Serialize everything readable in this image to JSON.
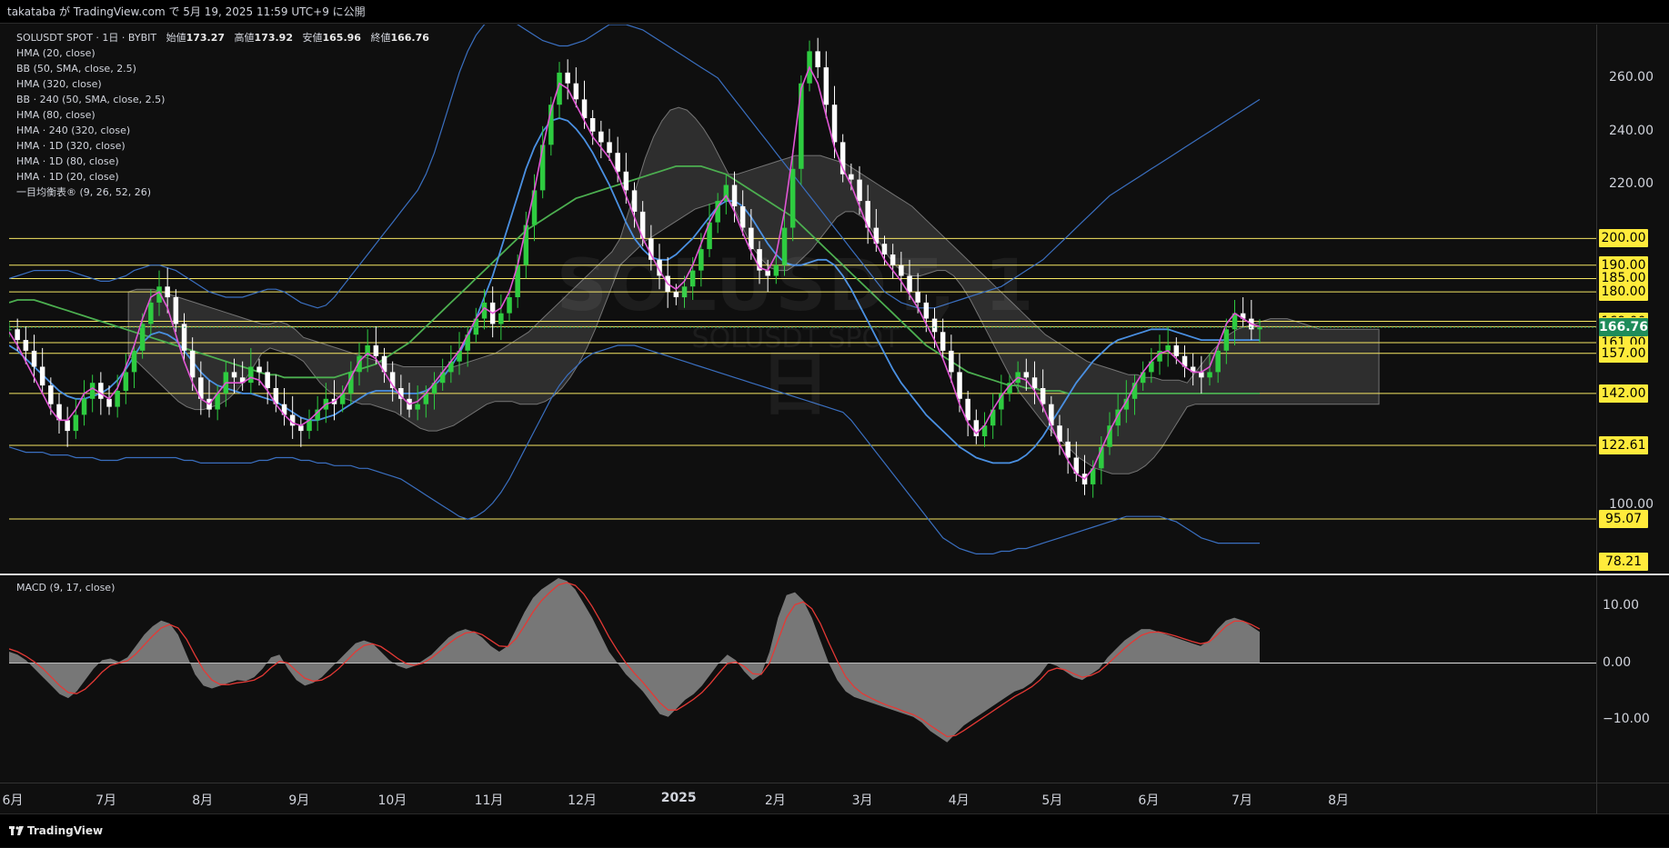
{
  "header": {
    "published": "takataba が TradingView.com で 5月 19, 2025 11:59 UTC+9 に公開"
  },
  "legend": {
    "symbol": "SOLUSDT SPOT · 1日 · BYBIT",
    "open_label": "始値",
    "open": "173.27",
    "high_label": "高値",
    "high": "173.92",
    "low_label": "安値",
    "low": "165.96",
    "close_label": "終値",
    "close": "166.76",
    "indicators": [
      "HMA (20, close)",
      "BB (50, SMA, close, 2.5)",
      "HMA (320, close)",
      "BB · 240 (50, SMA, close, 2.5)",
      "HMA (80, close)",
      "HMA · 240 (320, close)",
      "HMA · 1D (320, close)",
      "HMA · 1D (80, close)",
      "HMA · 1D (20, close)",
      "一目均衡表® (9, 26, 52, 26)"
    ]
  },
  "watermark": {
    "title": "SOLUSDT, 1日",
    "subtitle": "SOLUSDT SPOT"
  },
  "macd_legend": "MACD (9, 17, close)",
  "footer": {
    "brand": "TradingView"
  },
  "colors": {
    "up": "#2ecc40",
    "down": "#ffffff",
    "hma20": "#e056d4",
    "hma80": "#4a90e2",
    "hma320": "#4caf50",
    "bb": "#3a6fc0",
    "level": "#f5e663",
    "macd_hist": "#8a8a8a",
    "macd_signal": "#e53935"
  },
  "chart_data": [
    {
      "type": "candlestick",
      "title": "SOLUSDT SPOT · 1日 · BYBIT",
      "ylim": [
        75,
        280
      ],
      "x_ticks": [
        {
          "label": "6月",
          "pos": 0.0
        },
        {
          "label": "7月",
          "pos": 0.0588
        },
        {
          "label": "8月",
          "pos": 0.1196
        },
        {
          "label": "9月",
          "pos": 0.1804
        },
        {
          "label": "10月",
          "pos": 0.2392
        },
        {
          "label": "11月",
          "pos": 0.3
        },
        {
          "label": "12月",
          "pos": 0.3588
        },
        {
          "label": "2025",
          "pos": 0.4196
        },
        {
          "label": "2月",
          "pos": 0.4804
        },
        {
          "label": "3月",
          "pos": 0.5353
        },
        {
          "label": "4月",
          "pos": 0.5961
        },
        {
          "label": "5月",
          "pos": 0.6549
        },
        {
          "label": "6月",
          "pos": 0.7157
        },
        {
          "label": "7月",
          "pos": 0.7745
        },
        {
          "label": "8月",
          "pos": 0.8353
        }
      ],
      "y_ticks": [
        100,
        220,
        240,
        260
      ],
      "horizontal_levels": [
        200,
        190,
        185,
        180,
        169,
        167,
        161,
        157,
        142,
        122.61,
        95.07
      ],
      "price_tags": [
        "200.00",
        "190.00",
        "185.00",
        "180.00",
        "169.00",
        "167.00",
        "161.00",
        "157.00",
        "142.00",
        "122.61",
        "95.07",
        "78.21"
      ],
      "current_price": "166.76",
      "close_series": [
        166,
        162,
        158,
        152,
        145,
        138,
        132,
        128,
        134,
        140,
        146,
        140,
        137,
        143,
        150,
        158,
        168,
        176,
        182,
        178,
        168,
        158,
        148,
        140,
        136,
        142,
        150,
        148,
        146,
        152,
        150,
        144,
        138,
        134,
        130,
        128,
        132,
        136,
        140,
        138,
        142,
        150,
        156,
        160,
        156,
        150,
        144,
        140,
        136,
        138,
        142,
        146,
        150,
        154,
        158,
        164,
        170,
        176,
        168,
        172,
        178,
        190,
        205,
        218,
        235,
        250,
        262,
        258,
        252,
        245,
        240,
        236,
        232,
        225,
        218,
        210,
        200,
        192,
        186,
        180,
        178,
        182,
        188,
        196,
        206,
        214,
        220,
        212,
        204,
        196,
        188,
        186,
        190,
        204,
        226,
        258,
        270,
        264,
        250,
        236,
        224,
        222,
        214,
        204,
        198,
        194,
        190,
        186,
        180,
        176,
        170,
        165,
        158,
        150,
        140,
        132,
        126,
        130,
        136,
        142,
        146,
        150,
        148,
        144,
        138,
        130,
        124,
        118,
        112,
        108,
        114,
        122,
        130,
        136,
        140,
        146,
        150,
        154,
        158,
        160,
        156,
        152,
        150,
        148,
        150,
        158,
        166,
        172,
        170,
        166,
        166.76
      ],
      "hma20_series": [
        165,
        160,
        154,
        148,
        142,
        136,
        132,
        132,
        136,
        142,
        144,
        142,
        140,
        144,
        152,
        160,
        170,
        178,
        180,
        174,
        164,
        154,
        146,
        140,
        138,
        142,
        146,
        146,
        146,
        148,
        147,
        143,
        138,
        134,
        131,
        130,
        132,
        135,
        138,
        139,
        142,
        148,
        154,
        157,
        155,
        150,
        145,
        141,
        138,
        139,
        142,
        146,
        150,
        154,
        158,
        164,
        170,
        174,
        172,
        174,
        180,
        190,
        204,
        218,
        234,
        248,
        258,
        256,
        250,
        244,
        238,
        234,
        230,
        224,
        216,
        208,
        200,
        194,
        188,
        183,
        181,
        184,
        190,
        198,
        206,
        212,
        216,
        210,
        202,
        195,
        189,
        188,
        194,
        210,
        232,
        256,
        264,
        258,
        246,
        234,
        226,
        220,
        212,
        204,
        198,
        192,
        188,
        184,
        179,
        174,
        168,
        162,
        155,
        147,
        138,
        131,
        127,
        130,
        136,
        141,
        145,
        148,
        147,
        143,
        137,
        130,
        123,
        117,
        112,
        110,
        114,
        121,
        128,
        134,
        139,
        145,
        150,
        154,
        157,
        158,
        155,
        152,
        150,
        150,
        152,
        160,
        168,
        172,
        170,
        168,
        167
      ],
      "hma80_series": [
        160,
        158,
        155,
        152,
        149,
        146,
        143,
        141,
        140,
        140,
        141,
        142,
        144,
        147,
        151,
        156,
        161,
        164,
        165,
        164,
        162,
        158,
        154,
        150,
        147,
        145,
        144,
        143,
        142,
        142,
        141,
        140,
        139,
        137,
        135,
        133,
        132,
        132,
        133,
        134,
        136,
        138,
        140,
        142,
        143,
        143,
        143,
        142,
        142,
        142,
        143,
        145,
        148,
        152,
        157,
        163,
        170,
        178,
        186,
        196,
        206,
        216,
        226,
        234,
        240,
        244,
        245,
        244,
        241,
        237,
        232,
        226,
        220,
        213,
        206,
        200,
        196,
        193,
        192,
        192,
        194,
        197,
        200,
        204,
        208,
        212,
        214,
        214,
        212,
        208,
        203,
        198,
        194,
        191,
        190,
        190,
        191,
        192,
        192,
        190,
        186,
        181,
        175,
        169,
        163,
        157,
        151,
        146,
        142,
        138,
        134,
        131,
        128,
        125,
        122,
        120,
        118,
        117,
        116,
        116,
        116,
        117,
        119,
        122,
        126,
        131,
        136,
        141,
        146,
        150,
        154,
        157,
        160,
        162,
        163,
        164,
        165,
        166,
        166,
        166,
        165,
        164,
        163,
        162,
        162,
        162,
        162,
        162,
        162,
        162,
        162
      ],
      "hma320_series": [
        176,
        177,
        177,
        177,
        176,
        175,
        174,
        173,
        172,
        171,
        170,
        169,
        168,
        167,
        166,
        165,
        164,
        163,
        162,
        161,
        160,
        159,
        158,
        157,
        156,
        155,
        154,
        153,
        152,
        151,
        150,
        149,
        149,
        148,
        148,
        148,
        148,
        148,
        148,
        148,
        149,
        150,
        151,
        152,
        153,
        155,
        157,
        159,
        161,
        164,
        167,
        170,
        173,
        176,
        179,
        182,
        185,
        188,
        191,
        194,
        197,
        200,
        203,
        205,
        207,
        209,
        211,
        213,
        215,
        216,
        217,
        218,
        219,
        220,
        221,
        222,
        223,
        224,
        225,
        226,
        227,
        227,
        227,
        227,
        226,
        225,
        224,
        222,
        220,
        218,
        216,
        214,
        212,
        210,
        208,
        205,
        202,
        199,
        196,
        193,
        190,
        187,
        184,
        181,
        178,
        175,
        172,
        169,
        166,
        163,
        160,
        158,
        156,
        154,
        152,
        150,
        149,
        148,
        147,
        146,
        145,
        145,
        144,
        144,
        143,
        143,
        143,
        142,
        142,
        142,
        142,
        142,
        142,
        142,
        142,
        142,
        142,
        142,
        142,
        142,
        142,
        142,
        142,
        142,
        142,
        142,
        142,
        142,
        142,
        142,
        142
      ],
      "bb_upper": [
        185,
        186,
        187,
        188,
        188,
        188,
        188,
        188,
        187,
        186,
        185,
        184,
        184,
        185,
        186,
        188,
        189,
        190,
        190,
        189,
        188,
        186,
        184,
        182,
        180,
        179,
        178,
        178,
        178,
        179,
        180,
        181,
        181,
        180,
        178,
        176,
        175,
        174,
        175,
        178,
        182,
        186,
        190,
        194,
        198,
        202,
        206,
        210,
        214,
        218,
        224,
        232,
        242,
        252,
        262,
        270,
        276,
        280,
        282,
        283,
        282,
        280,
        278,
        276,
        274,
        273,
        272,
        272,
        273,
        274,
        276,
        278,
        280,
        280,
        280,
        279,
        278,
        276,
        274,
        272,
        270,
        268,
        266,
        264,
        262,
        260,
        256,
        252,
        248,
        244,
        240,
        236,
        232,
        228,
        224,
        220,
        216,
        212,
        208,
        204,
        200,
        196,
        192,
        188,
        184,
        180,
        178,
        176,
        175,
        174,
        174,
        174,
        175,
        176,
        177,
        178,
        179,
        180,
        181,
        182,
        184,
        186,
        188,
        190,
        192,
        195,
        198,
        201,
        204,
        207,
        210,
        213,
        216,
        218,
        220,
        222,
        224,
        226,
        228,
        230,
        232,
        234,
        236,
        238,
        240,
        242,
        244,
        246,
        248,
        250,
        252
      ],
      "bb_lower": [
        122,
        121,
        120,
        120,
        120,
        119,
        119,
        119,
        118,
        118,
        118,
        117,
        117,
        117,
        118,
        118,
        118,
        118,
        118,
        118,
        118,
        117,
        117,
        116,
        116,
        116,
        116,
        116,
        116,
        116,
        117,
        117,
        118,
        118,
        118,
        117,
        117,
        116,
        116,
        115,
        115,
        115,
        114,
        114,
        113,
        112,
        111,
        110,
        108,
        106,
        104,
        102,
        100,
        98,
        96,
        95,
        96,
        98,
        101,
        105,
        110,
        116,
        122,
        128,
        134,
        140,
        145,
        149,
        152,
        155,
        157,
        158,
        159,
        160,
        160,
        160,
        159,
        158,
        157,
        156,
        155,
        154,
        153,
        152,
        151,
        150,
        149,
        148,
        147,
        146,
        145,
        144,
        143,
        142,
        141,
        140,
        139,
        138,
        137,
        136,
        135,
        132,
        128,
        124,
        120,
        116,
        112,
        108,
        104,
        100,
        96,
        92,
        88,
        86,
        84,
        83,
        82,
        82,
        82,
        83,
        83,
        84,
        84,
        85,
        86,
        87,
        88,
        89,
        90,
        91,
        92,
        93,
        94,
        95,
        96,
        96,
        96,
        96,
        96,
        95,
        94,
        92,
        90,
        88,
        87,
        86,
        86,
        86,
        86,
        86,
        86
      ],
      "cloud_top": [],
      "cloud_bottom": []
    },
    {
      "type": "area",
      "title": "MACD (9, 17, close)",
      "ylim": [
        -15,
        15
      ],
      "y_ticks": [
        -10,
        0,
        10
      ],
      "hist_series": [
        2,
        1.5,
        0.5,
        -1,
        -2.5,
        -4,
        -5.5,
        -6.2,
        -5,
        -3,
        -1,
        0.5,
        0.8,
        0.2,
        1,
        3,
        5,
        6.5,
        7.5,
        7,
        5,
        1.5,
        -2,
        -4,
        -4.5,
        -4,
        -3.5,
        -3,
        -3.2,
        -2.5,
        -1,
        1,
        1.5,
        -1,
        -3,
        -4,
        -3.5,
        -2.5,
        -1,
        0.5,
        2,
        3.5,
        4,
        3.5,
        2,
        0.5,
        -0.5,
        -1,
        -0.5,
        0.5,
        1.5,
        3,
        4.5,
        5.5,
        6,
        5.5,
        4.5,
        3,
        2,
        3,
        6,
        9,
        11.5,
        13,
        14,
        15,
        14.5,
        13,
        10.5,
        8,
        5,
        2,
        0,
        -2,
        -3.5,
        -5,
        -7,
        -9,
        -9.5,
        -8,
        -6.5,
        -5.5,
        -4,
        -2,
        0,
        1.5,
        0.5,
        -1.5,
        -3,
        -2,
        2,
        8,
        12,
        12.5,
        11,
        8,
        4,
        0,
        -3,
        -5,
        -6,
        -6.5,
        -7,
        -7.5,
        -8,
        -8.5,
        -9,
        -9.5,
        -10.5,
        -12,
        -13,
        -14,
        -12.5,
        -11,
        -10,
        -9,
        -8,
        -7,
        -6,
        -5,
        -4.5,
        -3.5,
        -2,
        0,
        -0.5,
        -1.5,
        -2.5,
        -3,
        -2,
        -1,
        1,
        2.5,
        4,
        5,
        6,
        6,
        5.5,
        5,
        4.5,
        4,
        3.5,
        3,
        4,
        6,
        7.5,
        8,
        7.5,
        6.5,
        5.5
      ],
      "signal_series": [
        2.5,
        2,
        1.2,
        0.2,
        -1,
        -2.5,
        -4,
        -5.2,
        -5.4,
        -4.6,
        -3.2,
        -1.6,
        -0.4,
        0,
        0.4,
        1.6,
        3.2,
        4.8,
        6.2,
        6.8,
        6.2,
        4.2,
        1.4,
        -1.2,
        -3,
        -3.8,
        -3.8,
        -3.5,
        -3.3,
        -3,
        -2.2,
        -0.8,
        0.3,
        0,
        -1.4,
        -2.7,
        -3.2,
        -3,
        -2.2,
        -1,
        0.5,
        2,
        3.1,
        3.4,
        2.9,
        1.9,
        0.8,
        -0.1,
        -0.4,
        0,
        0.9,
        2.1,
        3.4,
        4.5,
        5.3,
        5.5,
        5,
        4,
        3,
        2.9,
        4.3,
        6.6,
        9,
        11,
        12.5,
        13.8,
        14.2,
        13.7,
        12.2,
        10,
        7.4,
        4.6,
        2.2,
        0,
        -1.8,
        -3.4,
        -5.2,
        -7,
        -8.3,
        -8.3,
        -7.4,
        -6.4,
        -5.2,
        -3.6,
        -1.8,
        -0.1,
        0.2,
        -0.6,
        -1.9,
        -2,
        0,
        4,
        8,
        10.3,
        10.8,
        9.6,
        7,
        3.6,
        0.4,
        -2.4,
        -4.2,
        -5.4,
        -6.2,
        -6.9,
        -7.5,
        -8,
        -8.6,
        -9.1,
        -9.9,
        -11,
        -12,
        -13,
        -12.8,
        -11.9,
        -10.9,
        -9.9,
        -8.9,
        -7.9,
        -6.9,
        -5.9,
        -5.1,
        -4.2,
        -3,
        -1.4,
        -0.9,
        -1.2,
        -1.9,
        -2.5,
        -2.2,
        -1.5,
        -0.2,
        1.2,
        2.6,
        3.8,
        4.9,
        5.4,
        5.5,
        5.2,
        4.8,
        4.3,
        3.8,
        3.4,
        3.7,
        5,
        6.5,
        7.4,
        7.4,
        6.8,
        6
      ]
    }
  ]
}
